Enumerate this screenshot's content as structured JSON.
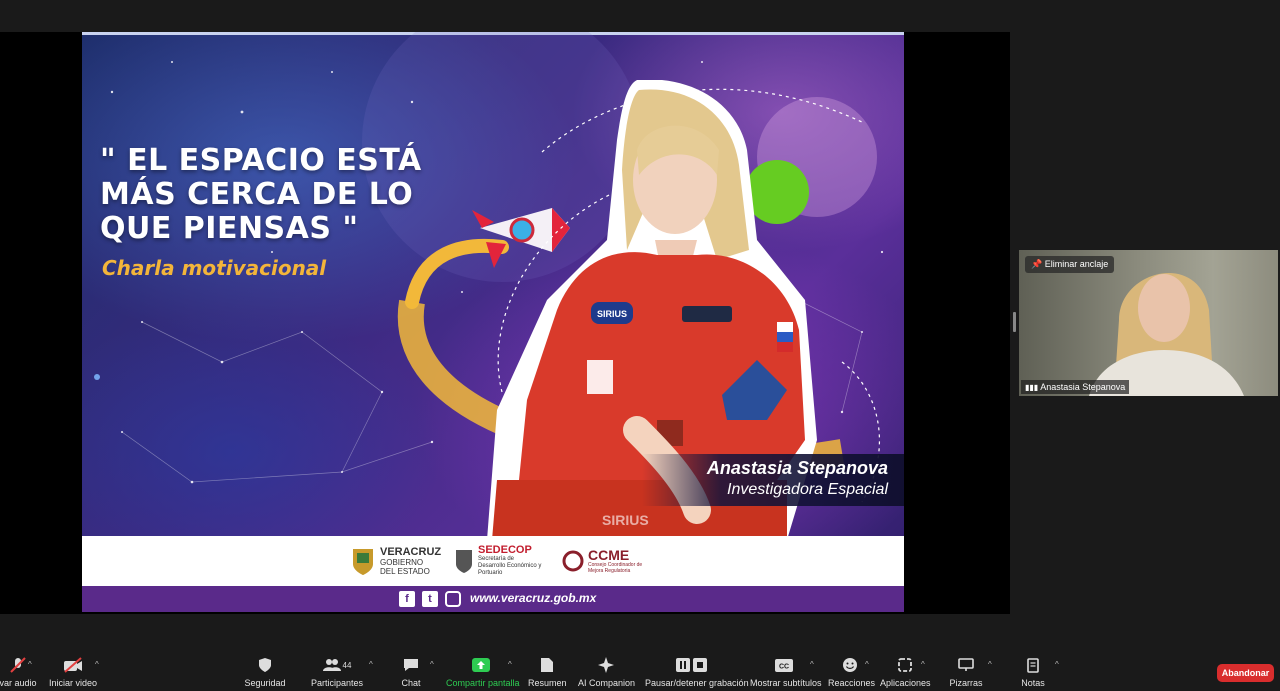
{
  "slide": {
    "quote": "\" EL ESPACIO ESTÁ MÁS CERCA DE LO QUE PIENSAS \"",
    "subtitle": "Charla motivacional",
    "speaker_name": "Anastasia Stepanova",
    "speaker_role": "Investigadora Espacial",
    "patch_text": "SIRIUS",
    "chest_text": "SIRIUS",
    "logos": [
      {
        "name": "VERACRUZ",
        "sub": "GOBIERNO DEL ESTADO"
      },
      {
        "name": "SEDECOP",
        "sub": "Secretaría de Desarrollo Económico y Portuario"
      },
      {
        "name": "CCME",
        "sub": "Consejo Coordinador de Mejora Regulatoria"
      }
    ],
    "website": "www.veracruz.gob.mx",
    "social_icons": [
      "facebook-icon",
      "twitter-icon",
      "instagram-icon"
    ],
    "colors": {
      "quote": "#ffffff",
      "subtitle": "#f3b53a",
      "footer": "#5a2a8a",
      "suit": "#d93a2b",
      "planet": "#66cc22"
    }
  },
  "participant": {
    "unpin_label": "Eliminar anclaje",
    "name": "Anastasia Stepanova"
  },
  "toolbar": {
    "audio_label": "var audio",
    "video_label": "Iniciar video",
    "security_label": "Seguridad",
    "participants_label": "Participantes",
    "participants_count": "44",
    "chat_label": "Chat",
    "share_label": "Compartir pantalla",
    "summary_label": "Resumen",
    "ai_label": "AI Companion",
    "record_label": "Pausar/detener grabación",
    "captions_label": "Mostrar subtítulos",
    "reactions_label": "Reacciones",
    "apps_label": "Aplicaciones",
    "whiteboards_label": "Pizarras",
    "notes_label": "Notas",
    "leave_label": "Abandonar",
    "share_color": "#2ecc52",
    "leave_color": "#d92d2d"
  }
}
